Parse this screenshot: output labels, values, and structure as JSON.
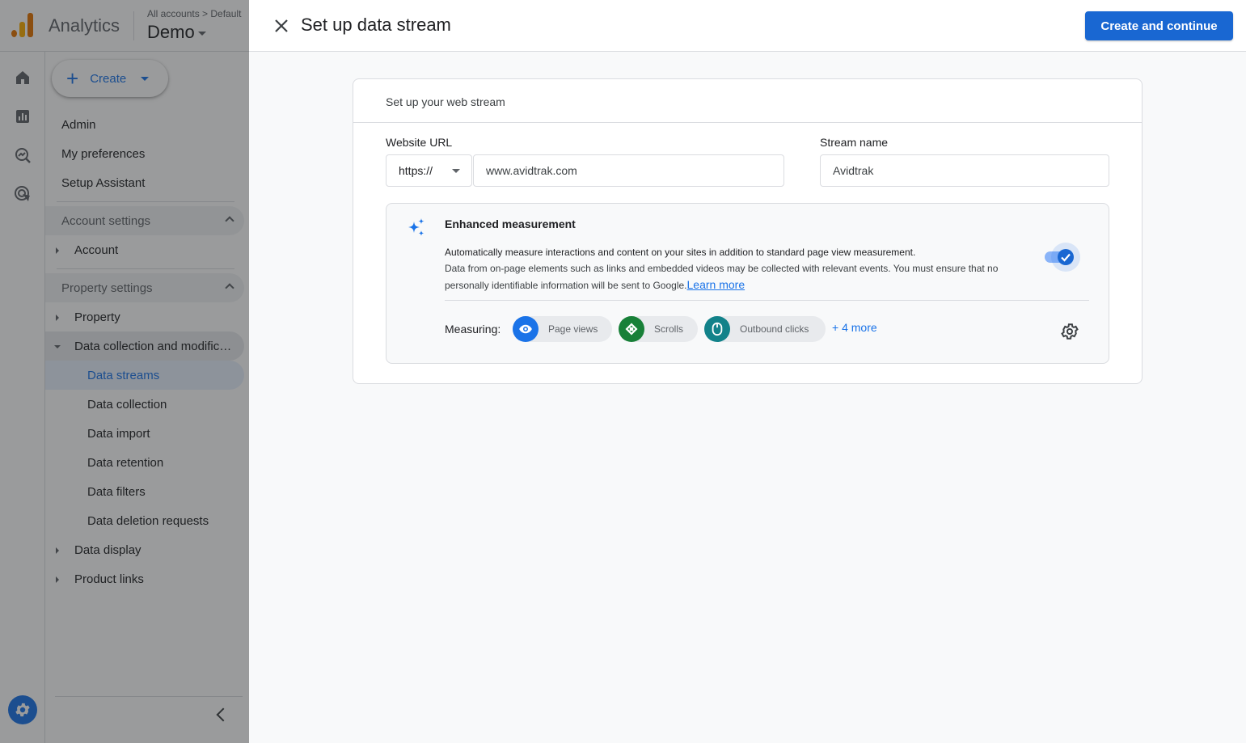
{
  "app": {
    "name": "Analytics",
    "breadcrumb": "All accounts > Default",
    "account_name": "Demo"
  },
  "sidenav": {
    "create_label": "Create",
    "top_items": [
      "Admin",
      "My preferences",
      "Setup Assistant"
    ],
    "account_settings": {
      "label": "Account settings",
      "items": [
        "Account"
      ]
    },
    "property_settings": {
      "label": "Property settings",
      "items": [
        "Property",
        "Data collection and modifica...",
        "Data display",
        "Product links"
      ],
      "sub_items": [
        "Data streams",
        "Data collection",
        "Data import",
        "Data retention",
        "Data filters",
        "Data deletion requests"
      ],
      "active_sub_item": "Data streams"
    }
  },
  "panel": {
    "title": "Set up data stream",
    "primary_button": "Create and continue",
    "card_title": "Set up your web stream",
    "website_url": {
      "label": "Website URL",
      "protocol": "https://",
      "value": "www.avidtrak.com"
    },
    "stream_name": {
      "label": "Stream name",
      "value": "Avidtrak"
    },
    "enhanced_measurement": {
      "title": "Enhanced measurement",
      "description_strong": "Automatically measure interactions and content on your sites in addition to standard page view measurement.",
      "description": "Data from on-page elements such as links and embedded videos may be collected with relevant events. You must ensure that no personally identifiable information will be sent to Google.",
      "learn_more": "Learn more",
      "enabled": true,
      "measuring_label": "Measuring:",
      "chips": [
        {
          "label": "Page views",
          "icon": "eye-icon",
          "color": "#1a73e8"
        },
        {
          "label": "Scrolls",
          "icon": "scroll-icon",
          "color": "#188038"
        },
        {
          "label": "Outbound clicks",
          "icon": "mouse-icon",
          "color": "#12828a"
        }
      ],
      "more_label": "+ 4 more"
    }
  },
  "colors": {
    "primary": "#1967d2",
    "link": "#1a73e8"
  }
}
